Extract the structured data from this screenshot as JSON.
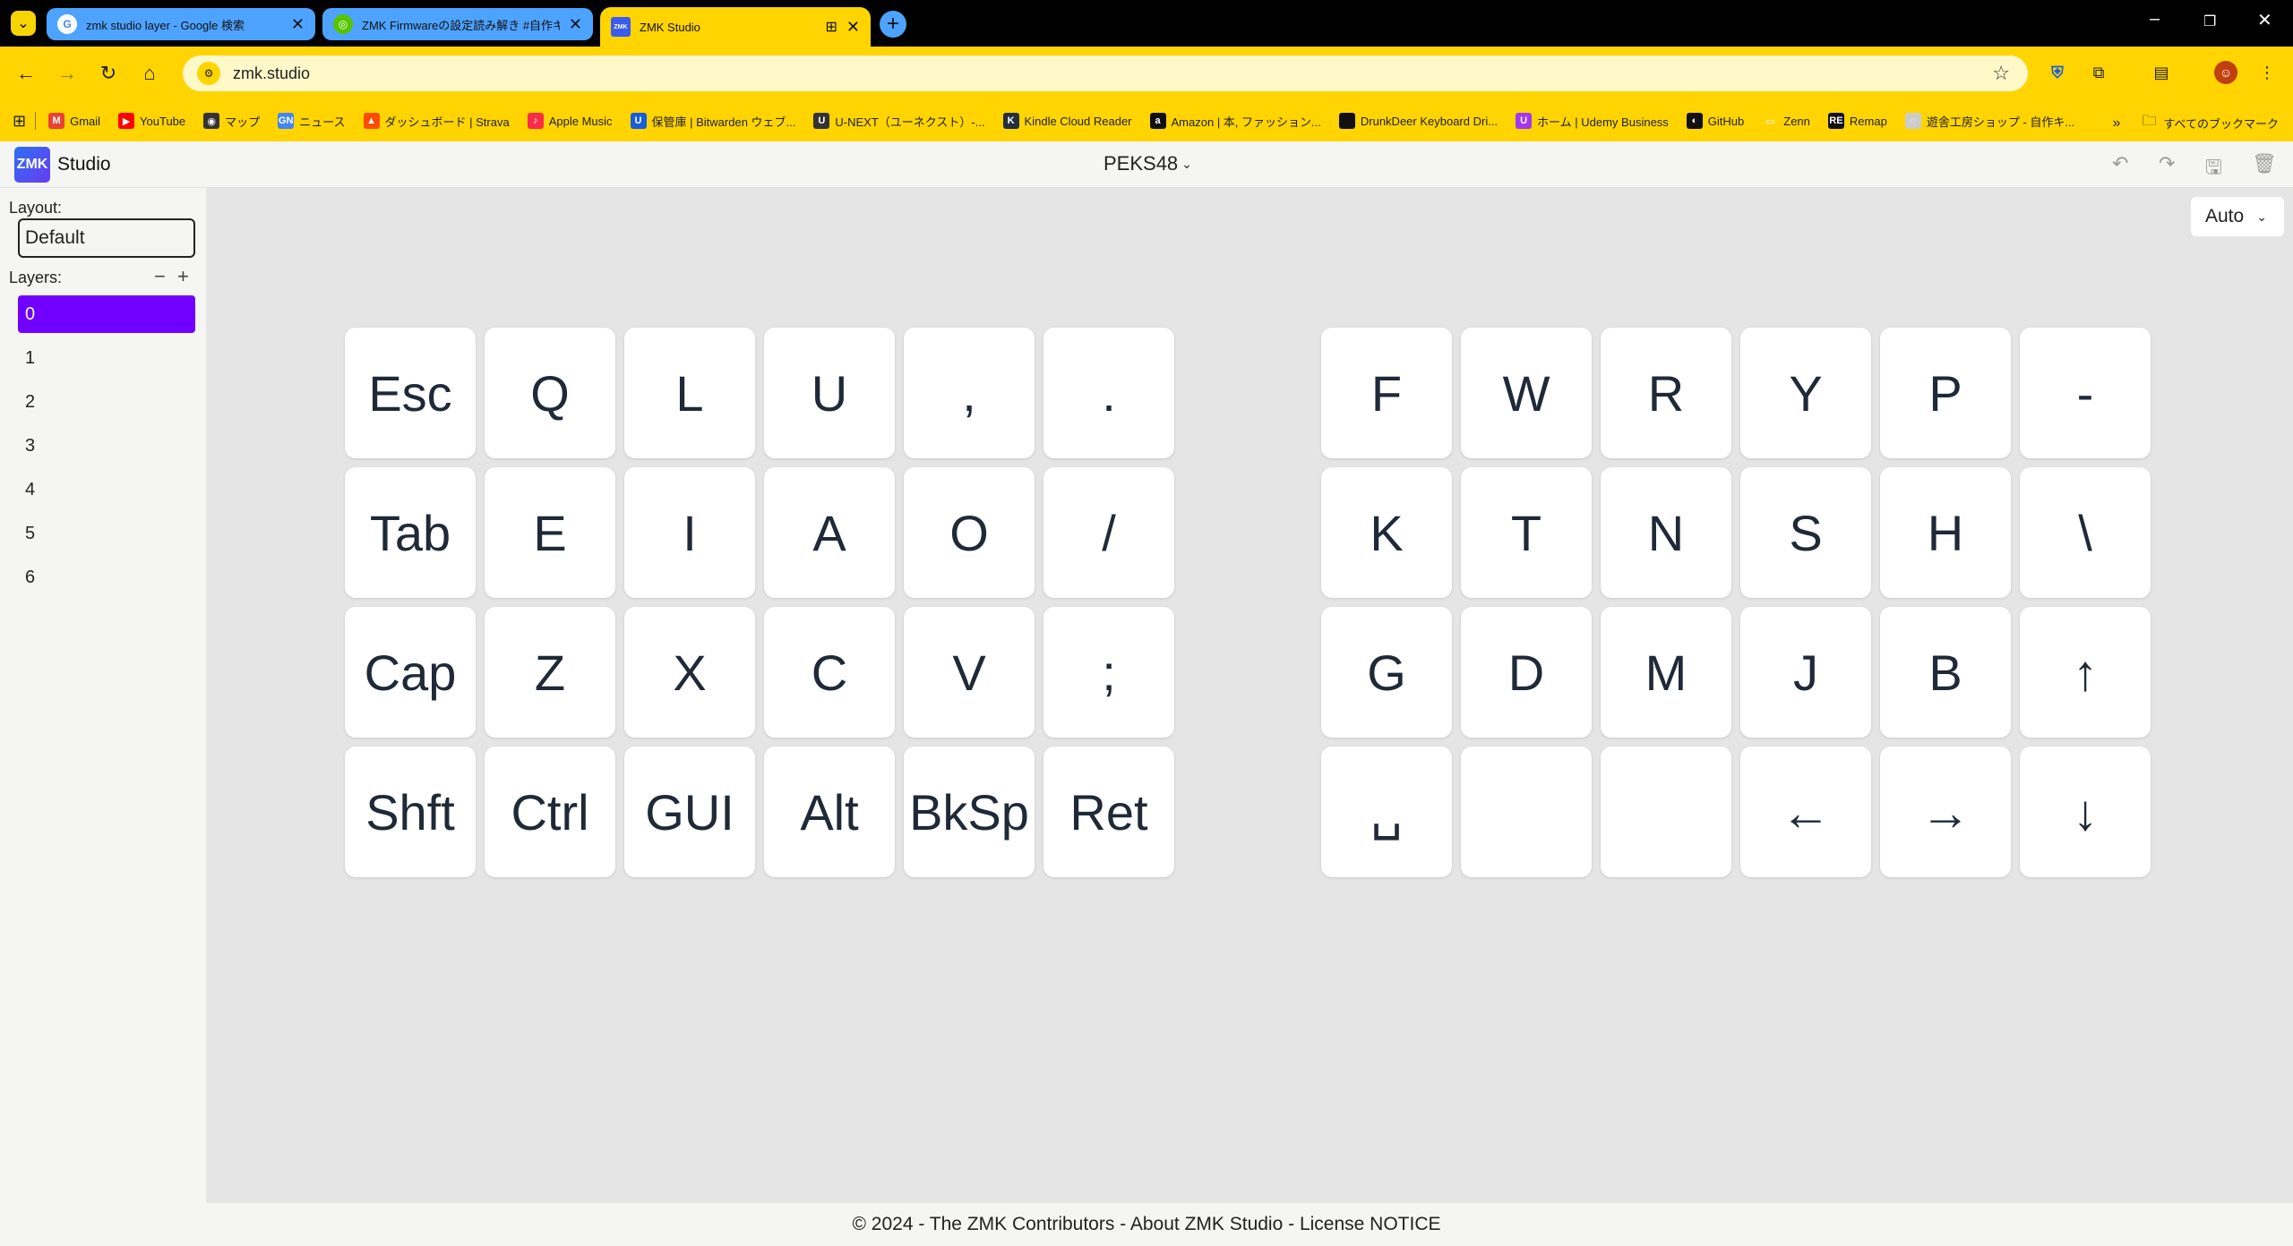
{
  "browser": {
    "tabs": [
      {
        "title": "zmk studio layer - Google 検索",
        "favicon": "G",
        "favicon_color": "#ffffff"
      },
      {
        "title": "ZMK Firmwareの設定読み解き #自作キ",
        "favicon": "◎",
        "favicon_color": "#55c500"
      },
      {
        "title": "ZMK Studio",
        "favicon": "ZMK",
        "favicon_color": "#3b5bf0"
      }
    ],
    "url": "zmk.studio",
    "bookmarks": [
      {
        "label": "Gmail",
        "icon": "M",
        "color": "#ea4335"
      },
      {
        "label": "YouTube",
        "icon": "▶",
        "color": "#ff0000"
      },
      {
        "label": "マップ",
        "icon": "◉",
        "color": "#333333"
      },
      {
        "label": "ニュース",
        "icon": "GN",
        "color": "#4285f4"
      },
      {
        "label": "ダッシュボード | Strava",
        "icon": "▲",
        "color": "#fc4c02"
      },
      {
        "label": "Apple Music",
        "icon": "♪",
        "color": "#fa2d48"
      },
      {
        "label": "保管庫 | Bitwarden ウェブ...",
        "icon": "U",
        "color": "#175ddc"
      },
      {
        "label": "U-NEXT（ユーネクスト）-...",
        "icon": "U",
        "color": "#333333"
      },
      {
        "label": "Kindle Cloud Reader",
        "icon": "K",
        "color": "#232f3e"
      },
      {
        "label": "Amazon | 本, ファッション...",
        "icon": "a",
        "color": "#111111"
      },
      {
        "label": "DrunkDeer Keyboard Dri...",
        "icon": "",
        "color": "#111111"
      },
      {
        "label": "ホーム | Udemy Business",
        "icon": "U",
        "color": "#a435f0"
      },
      {
        "label": "GitHub",
        "icon": "◐",
        "color": "#111111"
      },
      {
        "label": "Zenn",
        "icon": "▭",
        "color": "#ffd400"
      },
      {
        "label": "Remap",
        "icon": "RE",
        "color": "#111111"
      },
      {
        "label": "遊舎工房ショップ - 自作キ...",
        "icon": "◌",
        "color": "#cccccc"
      }
    ],
    "all_bookmarks": "すべてのブックマーク"
  },
  "app": {
    "brand_badge": "ZMK",
    "brand_name": "Studio",
    "keyboard_name": "PEKS48",
    "layout_label": "Layout:",
    "layout_value": "Default",
    "layers_label": "Layers:",
    "layer_minus": "−",
    "layer_plus": "+",
    "layers": [
      "0",
      "1",
      "2",
      "3",
      "4",
      "5",
      "6"
    ],
    "selected_layer": "0",
    "zoom_select": "Auto",
    "accent_color": "#7000ff",
    "footer": "© 2024 - The ZMK Contributors - About ZMK Studio - License NOTICE"
  },
  "keymap": {
    "left": [
      [
        "Esc",
        "Q",
        "L",
        "U",
        ",",
        "."
      ],
      [
        "Tab",
        "E",
        "I",
        "A",
        "O",
        "/"
      ],
      [
        "Cap",
        "Z",
        "X",
        "C",
        "V",
        ";"
      ],
      [
        "Shft",
        "Ctrl",
        "GUI",
        "Alt",
        "BkSp",
        "Ret"
      ]
    ],
    "right": [
      [
        "F",
        "W",
        "R",
        "Y",
        "P",
        "-"
      ],
      [
        "K",
        "T",
        "N",
        "S",
        "H",
        "\\"
      ],
      [
        "G",
        "D",
        "M",
        "J",
        "B",
        "↑"
      ],
      [
        "␣",
        "",
        "",
        "←",
        "→",
        "↓"
      ]
    ]
  }
}
